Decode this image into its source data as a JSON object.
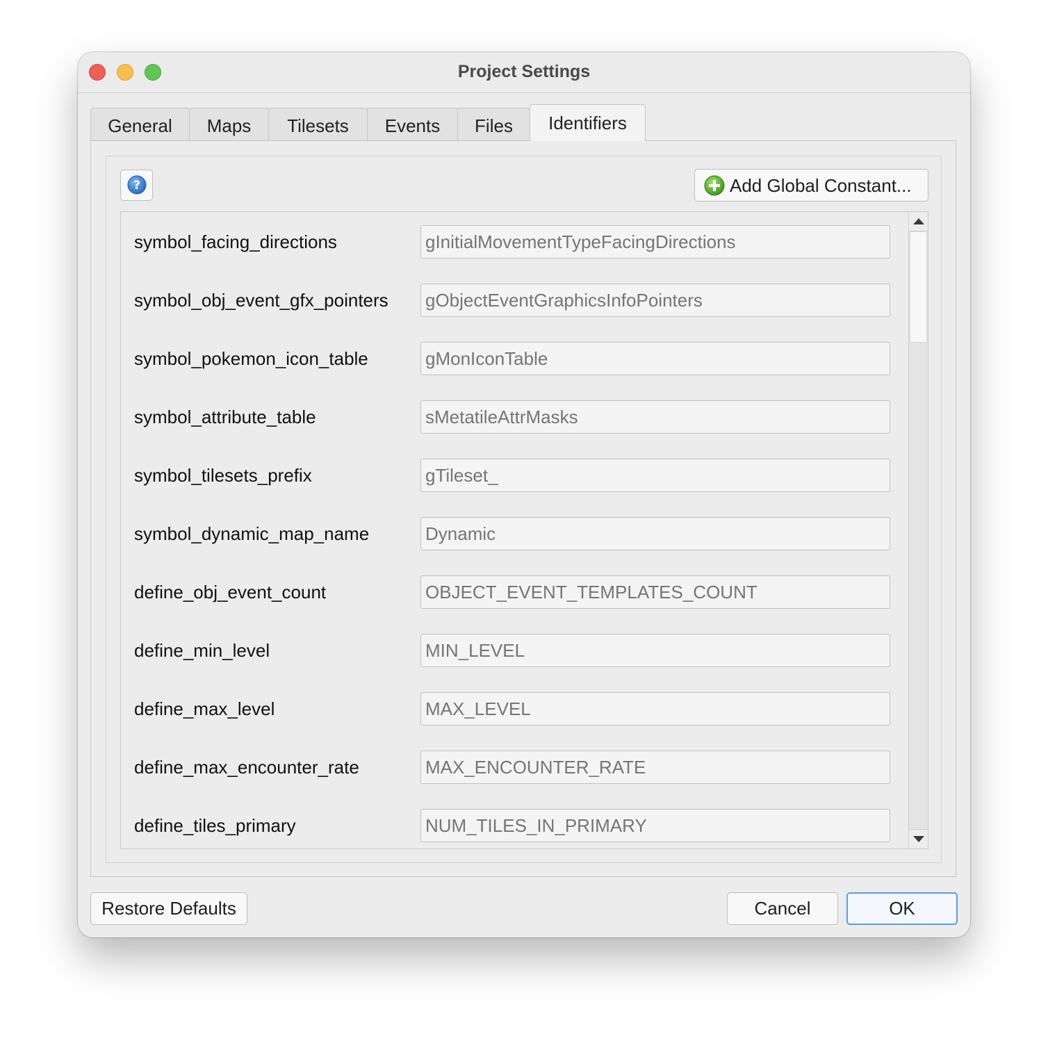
{
  "window": {
    "title": "Project Settings"
  },
  "tabs": [
    {
      "label": "General",
      "active": false
    },
    {
      "label": "Maps",
      "active": false
    },
    {
      "label": "Tilesets",
      "active": false
    },
    {
      "label": "Events",
      "active": false
    },
    {
      "label": "Files",
      "active": false
    },
    {
      "label": "Identifiers",
      "active": true
    }
  ],
  "toolbar": {
    "help_icon": "question-mark-icon",
    "add_icon": "plus-circle-icon",
    "add_label": "Add Global Constant..."
  },
  "identifiers": [
    {
      "label": "symbol_facing_directions",
      "placeholder": "gInitialMovementTypeFacingDirections"
    },
    {
      "label": "symbol_obj_event_gfx_pointers",
      "placeholder": "gObjectEventGraphicsInfoPointers"
    },
    {
      "label": "symbol_pokemon_icon_table",
      "placeholder": "gMonIconTable"
    },
    {
      "label": "symbol_attribute_table",
      "placeholder": "sMetatileAttrMasks"
    },
    {
      "label": "symbol_tilesets_prefix",
      "placeholder": "gTileset_"
    },
    {
      "label": "symbol_dynamic_map_name",
      "placeholder": "Dynamic"
    },
    {
      "label": "define_obj_event_count",
      "placeholder": "OBJECT_EVENT_TEMPLATES_COUNT"
    },
    {
      "label": "define_min_level",
      "placeholder": "MIN_LEVEL"
    },
    {
      "label": "define_max_level",
      "placeholder": "MAX_LEVEL"
    },
    {
      "label": "define_max_encounter_rate",
      "placeholder": "MAX_ENCOUNTER_RATE"
    },
    {
      "label": "define_tiles_primary",
      "placeholder": "NUM_TILES_IN_PRIMARY"
    }
  ],
  "footer": {
    "restore_label": "Restore Defaults",
    "cancel_label": "Cancel",
    "ok_label": "OK"
  },
  "colors": {
    "close": "#ee5f56",
    "minimize": "#f6be4f",
    "maximize": "#61c555",
    "ok_border": "#5a9ae8",
    "add_icon": "#5cb82f",
    "help_icon": "#3a7fd5"
  }
}
